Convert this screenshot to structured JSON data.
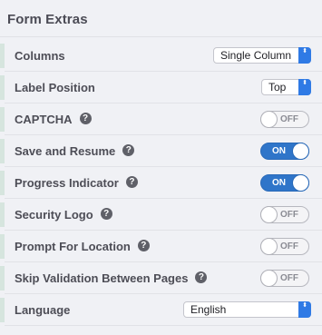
{
  "section": {
    "title": "Form Extras"
  },
  "rows": [
    {
      "label": "Columns",
      "control": "select",
      "value": "Single Column"
    },
    {
      "label": "Label Position",
      "control": "select",
      "value": "Top"
    },
    {
      "label": "CAPTCHA",
      "help": "?",
      "control": "toggle",
      "state": "OFF"
    },
    {
      "label": "Save and Resume",
      "help": "?",
      "control": "toggle",
      "state": "ON"
    },
    {
      "label": "Progress Indicator",
      "help": "?",
      "control": "toggle",
      "state": "ON"
    },
    {
      "label": "Security Logo",
      "help": "?",
      "control": "toggle",
      "state": "OFF"
    },
    {
      "label": "Prompt For Location",
      "help": "?",
      "control": "toggle",
      "state": "OFF"
    },
    {
      "label": "Skip Validation Between Pages",
      "help": "?",
      "control": "toggle",
      "state": "OFF"
    },
    {
      "label": "Language",
      "control": "select",
      "value": "English"
    }
  ],
  "select_arrow": "⬍",
  "colors": {
    "background": "#f0f1f5",
    "toggle_on": "#2f75c9",
    "select_arrow": "#2f7ae5",
    "row_accent": "#d6e5de"
  }
}
